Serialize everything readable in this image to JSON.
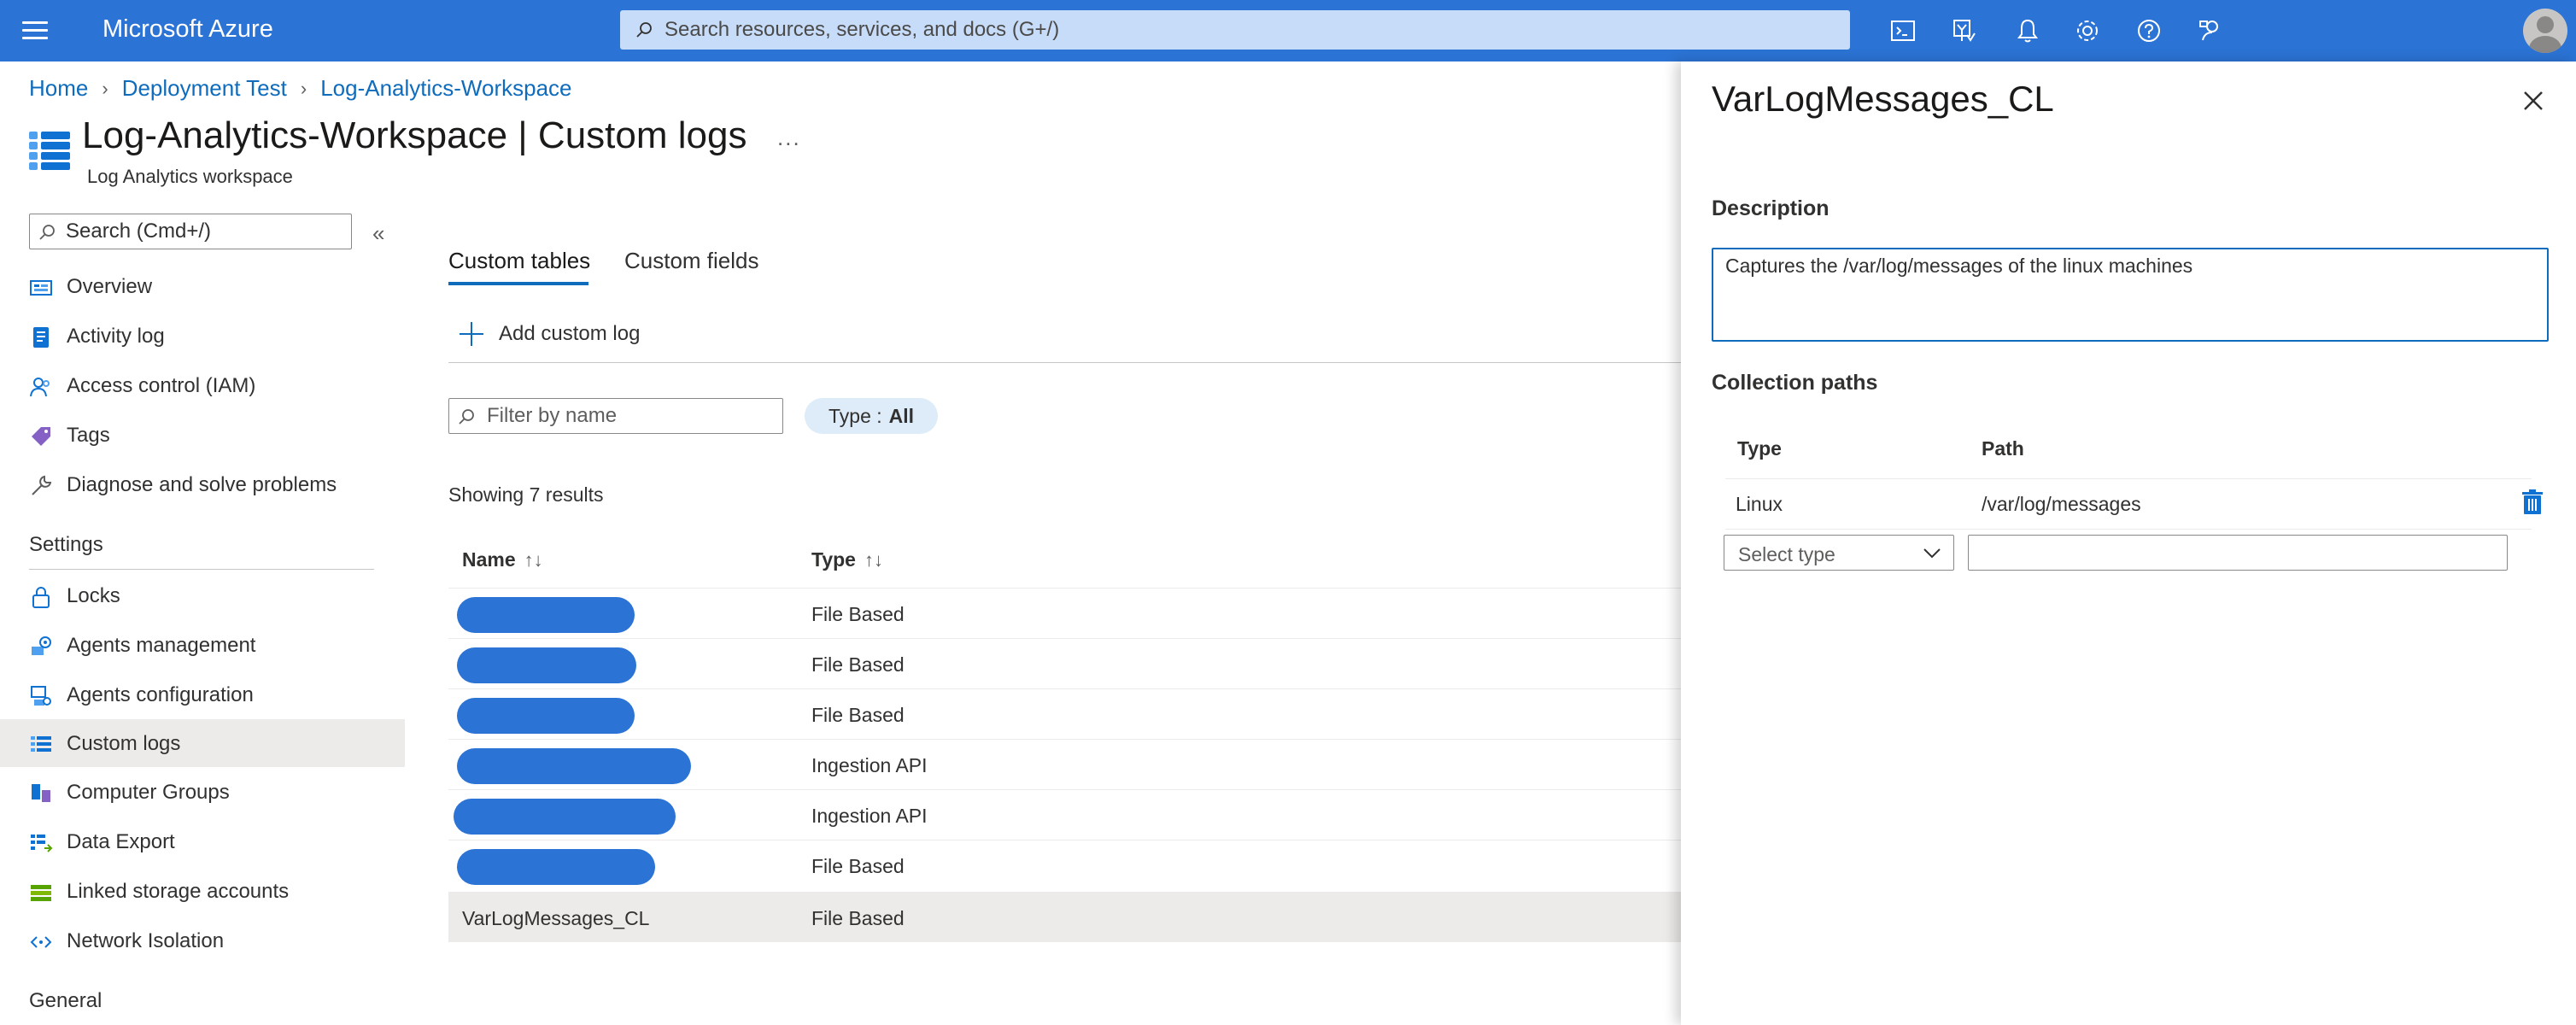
{
  "topbar": {
    "brand": "Microsoft Azure",
    "search_placeholder": "Search resources, services, and docs (G+/)",
    "icons": [
      "cloud-shell-icon",
      "directory-filter-icon",
      "notifications-icon",
      "settings-icon",
      "help-icon",
      "feedback-icon"
    ],
    "accent": "#2b73d4"
  },
  "breadcrumb": [
    "Home",
    "Deployment Test",
    "Log-Analytics-Workspace"
  ],
  "resource": {
    "title": "Log-Analytics-Workspace | Custom logs",
    "subtitle": "Log Analytics workspace",
    "more": "..."
  },
  "sidebar": {
    "search_placeholder": "Search (Cmd+/)",
    "collapse": "«",
    "items": [
      {
        "label": "Overview",
        "icon": "overview-icon"
      },
      {
        "label": "Activity log",
        "icon": "activity-log-icon"
      },
      {
        "label": "Access control (IAM)",
        "icon": "iam-icon"
      },
      {
        "label": "Tags",
        "icon": "tag-icon"
      },
      {
        "label": "Diagnose and solve problems",
        "icon": "wrench-icon"
      }
    ],
    "settings_heading": "Settings",
    "settings_items": [
      {
        "label": "Locks",
        "icon": "lock-icon"
      },
      {
        "label": "Agents management",
        "icon": "agents-management-icon"
      },
      {
        "label": "Agents configuration",
        "icon": "agents-configuration-icon"
      },
      {
        "label": "Custom logs",
        "icon": "custom-logs-icon",
        "active": true
      },
      {
        "label": "Computer Groups",
        "icon": "computer-groups-icon"
      },
      {
        "label": "Data Export",
        "icon": "data-export-icon"
      },
      {
        "label": "Linked storage accounts",
        "icon": "storage-icon"
      },
      {
        "label": "Network Isolation",
        "icon": "network-isolation-icon"
      }
    ],
    "general_heading": "General"
  },
  "main": {
    "tabs": [
      {
        "label": "Custom tables",
        "active": true
      },
      {
        "label": "Custom fields",
        "active": false
      }
    ],
    "add_button": "Add custom log",
    "filter_placeholder": "Filter by name",
    "type_filter": {
      "label": "Type : ",
      "value": "All"
    },
    "showing": "Showing 7 results",
    "columns": {
      "name": "Name",
      "type": "Type",
      "name_sort": "↑↓",
      "type_sort": "↑↓"
    },
    "rows": [
      {
        "name": "",
        "type": "File Based",
        "redacted": true
      },
      {
        "name": "",
        "type": "File Based",
        "redacted": true
      },
      {
        "name": "",
        "type": "File Based",
        "redacted": true
      },
      {
        "name": "",
        "type": "Ingestion API",
        "redacted": true
      },
      {
        "name": "",
        "type": "Ingestion API",
        "redacted": true
      },
      {
        "name": "",
        "type": "File Based",
        "redacted": true
      },
      {
        "name": "VarLogMessages_CL",
        "type": "File Based",
        "redacted": false,
        "selected": true
      }
    ]
  },
  "panel": {
    "title": "VarLogMessages_CL",
    "description_label": "Description",
    "description_value": "Captures the /var/log/messages of the linux machines",
    "collection_paths_label": "Collection paths",
    "col_type": "Type",
    "col_path": "Path",
    "paths": [
      {
        "type": "Linux",
        "path": "/var/log/messages"
      }
    ],
    "select_type_placeholder": "Select type",
    "path_value": ""
  }
}
